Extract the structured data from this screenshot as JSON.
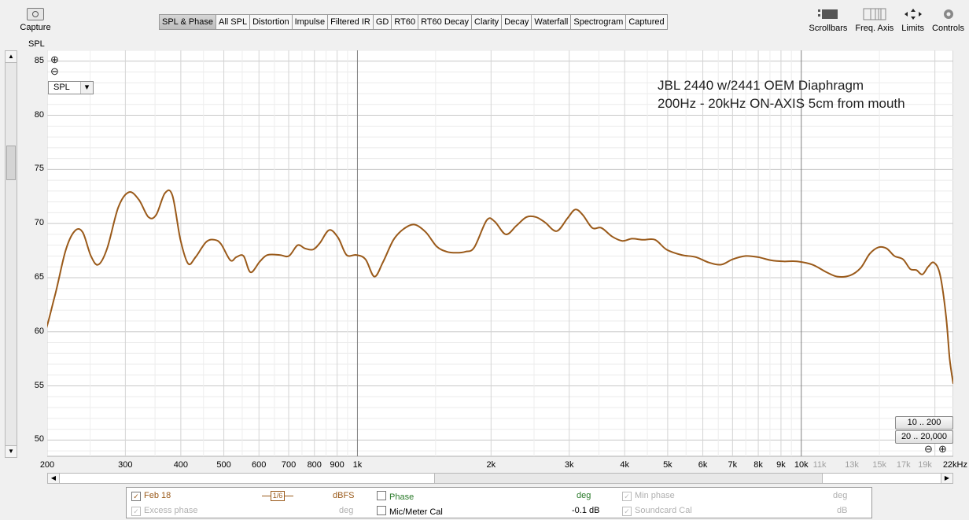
{
  "toolbar": {
    "capture_label": "Capture",
    "tabs": [
      "SPL & Phase",
      "All SPL",
      "Distortion",
      "Impulse",
      "Filtered IR",
      "GD",
      "RT60",
      "RT60 Decay",
      "Clarity",
      "Decay",
      "Waterfall",
      "Spectrogram",
      "Captured"
    ],
    "active_tab": "SPL & Phase",
    "right_tools": [
      "Scrollbars",
      "Freq. Axis",
      "Limits",
      "Controls"
    ]
  },
  "axis_side_label": "SPL",
  "plot_controls": {
    "zoom_in_icon": "⊕",
    "zoom_out_icon": "⊖",
    "dropdown_value": "SPL",
    "range_buttons": [
      "10 .. 200",
      "20 .. 20,000"
    ]
  },
  "colors": {
    "trace": "#9a5a1a",
    "grid_minor": "#e6e6e6",
    "grid_major": "#808080"
  },
  "chart_data": {
    "type": "line",
    "annotation": [
      "JBL 2440 w/2441 OEM Diaphragm",
      "200Hz - 20kHz ON-AXIS 5cm from mouth"
    ],
    "xscale": "log",
    "xlim": [
      200,
      22000
    ],
    "ylim": [
      48.5,
      86
    ],
    "x_tick_labels": [
      {
        "f": 200,
        "label": "200",
        "dim": false
      },
      {
        "f": 300,
        "label": "300",
        "dim": false
      },
      {
        "f": 400,
        "label": "400",
        "dim": false
      },
      {
        "f": 500,
        "label": "500",
        "dim": false
      },
      {
        "f": 600,
        "label": "600",
        "dim": false
      },
      {
        "f": 700,
        "label": "700",
        "dim": false
      },
      {
        "f": 800,
        "label": "800",
        "dim": false
      },
      {
        "f": 900,
        "label": "900",
        "dim": false
      },
      {
        "f": 1000,
        "label": "1k",
        "dim": false
      },
      {
        "f": 2000,
        "label": "2k",
        "dim": false
      },
      {
        "f": 3000,
        "label": "3k",
        "dim": false
      },
      {
        "f": 4000,
        "label": "4k",
        "dim": false
      },
      {
        "f": 5000,
        "label": "5k",
        "dim": false
      },
      {
        "f": 6000,
        "label": "6k",
        "dim": false
      },
      {
        "f": 7000,
        "label": "7k",
        "dim": false
      },
      {
        "f": 8000,
        "label": "8k",
        "dim": false
      },
      {
        "f": 9000,
        "label": "9k",
        "dim": false
      },
      {
        "f": 10000,
        "label": "10k",
        "dim": false
      },
      {
        "f": 11000,
        "label": "11k",
        "dim": true
      },
      {
        "f": 13000,
        "label": "13k",
        "dim": true
      },
      {
        "f": 15000,
        "label": "15k",
        "dim": true
      },
      {
        "f": 17000,
        "label": "17k",
        "dim": true
      },
      {
        "f": 19000,
        "label": "19k",
        "dim": true
      },
      {
        "f": 22000,
        "label": "22kHz",
        "dim": false
      }
    ],
    "y_tick_labels": [
      "50",
      "55",
      "60",
      "65",
      "70",
      "75",
      "80",
      "85"
    ],
    "series": [
      {
        "name": "Feb 18",
        "points": [
          [
            213,
            62.4
          ],
          [
            220,
            61.4
          ],
          [
            230,
            61.4
          ],
          [
            240,
            59.6
          ],
          [
            255,
            63.2
          ],
          [
            270,
            67.5
          ],
          [
            283,
            69.3
          ],
          [
            295,
            69.2
          ],
          [
            308,
            67
          ],
          [
            320,
            66.2
          ],
          [
            335,
            67.7
          ],
          [
            355,
            71.5
          ],
          [
            375,
            72.9
          ],
          [
            395,
            72.2
          ],
          [
            415,
            70.6
          ],
          [
            432,
            70.8
          ],
          [
            452,
            72.8
          ],
          [
            470,
            72.6
          ],
          [
            490,
            68.5
          ],
          [
            510,
            66.3
          ],
          [
            530,
            66.9
          ],
          [
            560,
            68.3
          ],
          [
            585,
            68.5
          ],
          [
            605,
            68.1
          ],
          [
            635,
            66.6
          ],
          [
            655,
            66.9
          ],
          [
            680,
            67
          ],
          [
            705,
            65.5
          ],
          [
            740,
            66.5
          ],
          [
            770,
            67.1
          ],
          [
            820,
            67.1
          ],
          [
            860,
            67
          ],
          [
            900,
            68
          ],
          [
            935,
            67.7
          ],
          [
            975,
            67.6
          ],
          [
            1010,
            68.2
          ],
          [
            1060,
            69.4
          ],
          [
            1110,
            68.7
          ],
          [
            1160,
            67.1
          ],
          [
            1220,
            67.1
          ],
          [
            1280,
            66.7
          ],
          [
            1340,
            65.1
          ],
          [
            1400,
            66.4
          ],
          [
            1480,
            68.5
          ],
          [
            1560,
            69.5
          ],
          [
            1650,
            69.9
          ],
          [
            1750,
            69.2
          ],
          [
            1850,
            67.9
          ],
          [
            1950,
            67.4
          ],
          [
            2050,
            67.3
          ],
          [
            2150,
            67.4
          ],
          [
            2250,
            67.8
          ],
          [
            2400,
            70.3
          ],
          [
            2500,
            70.2
          ],
          [
            2650,
            69
          ],
          [
            2800,
            69.8
          ],
          [
            2950,
            70.6
          ],
          [
            3100,
            70.6
          ],
          [
            3250,
            70.1
          ],
          [
            3450,
            69.3
          ],
          [
            3650,
            70.5
          ],
          [
            3800,
            71.3
          ],
          [
            3950,
            70.8
          ],
          [
            4150,
            69.6
          ],
          [
            4350,
            69.6
          ],
          [
            4600,
            68.8
          ],
          [
            4850,
            68.4
          ],
          [
            5100,
            68.6
          ],
          [
            5400,
            68.5
          ],
          [
            5750,
            68.5
          ],
          [
            6100,
            67.6
          ],
          [
            6600,
            67.1
          ],
          [
            7100,
            66.9
          ],
          [
            7600,
            66.4
          ],
          [
            8100,
            66.2
          ],
          [
            8600,
            66.7
          ],
          [
            9200,
            67
          ],
          [
            9800,
            66.9
          ],
          [
            10500,
            66.6
          ],
          [
            11200,
            66.5
          ],
          [
            12000,
            66.5
          ],
          [
            13000,
            66.2
          ],
          [
            14000,
            65.5
          ],
          [
            14800,
            65.1
          ],
          [
            15800,
            65.2
          ],
          [
            16700,
            65.9
          ],
          [
            17500,
            67.2
          ],
          [
            18300,
            67.8
          ],
          [
            19100,
            67.7
          ],
          [
            19900,
            67
          ],
          [
            20800,
            66.7
          ],
          [
            21600,
            65.8
          ],
          [
            22300,
            65.7
          ],
          [
            23000,
            65.3
          ],
          [
            23700,
            66
          ],
          [
            24400,
            66.4
          ],
          [
            25200,
            65.3
          ],
          [
            26000,
            61.5
          ],
          [
            26500,
            57.5
          ],
          [
            27000,
            55.2
          ]
        ]
      }
    ]
  },
  "legend": {
    "row1": {
      "series_name": "Feb 18",
      "smoothing": "1/6",
      "unit1": "dBFS",
      "phase_label": "Phase",
      "unit2": "deg",
      "min_phase_label": "Min phase",
      "unit3": "deg"
    },
    "row2": {
      "excess_phase_label": "Excess phase",
      "unit1": "deg",
      "mic_cal_label": "Mic/Meter Cal",
      "mic_cal_value": "-0.1 dB",
      "soundcard_cal_label": "Soundcard Cal",
      "unit3": "dB"
    }
  }
}
